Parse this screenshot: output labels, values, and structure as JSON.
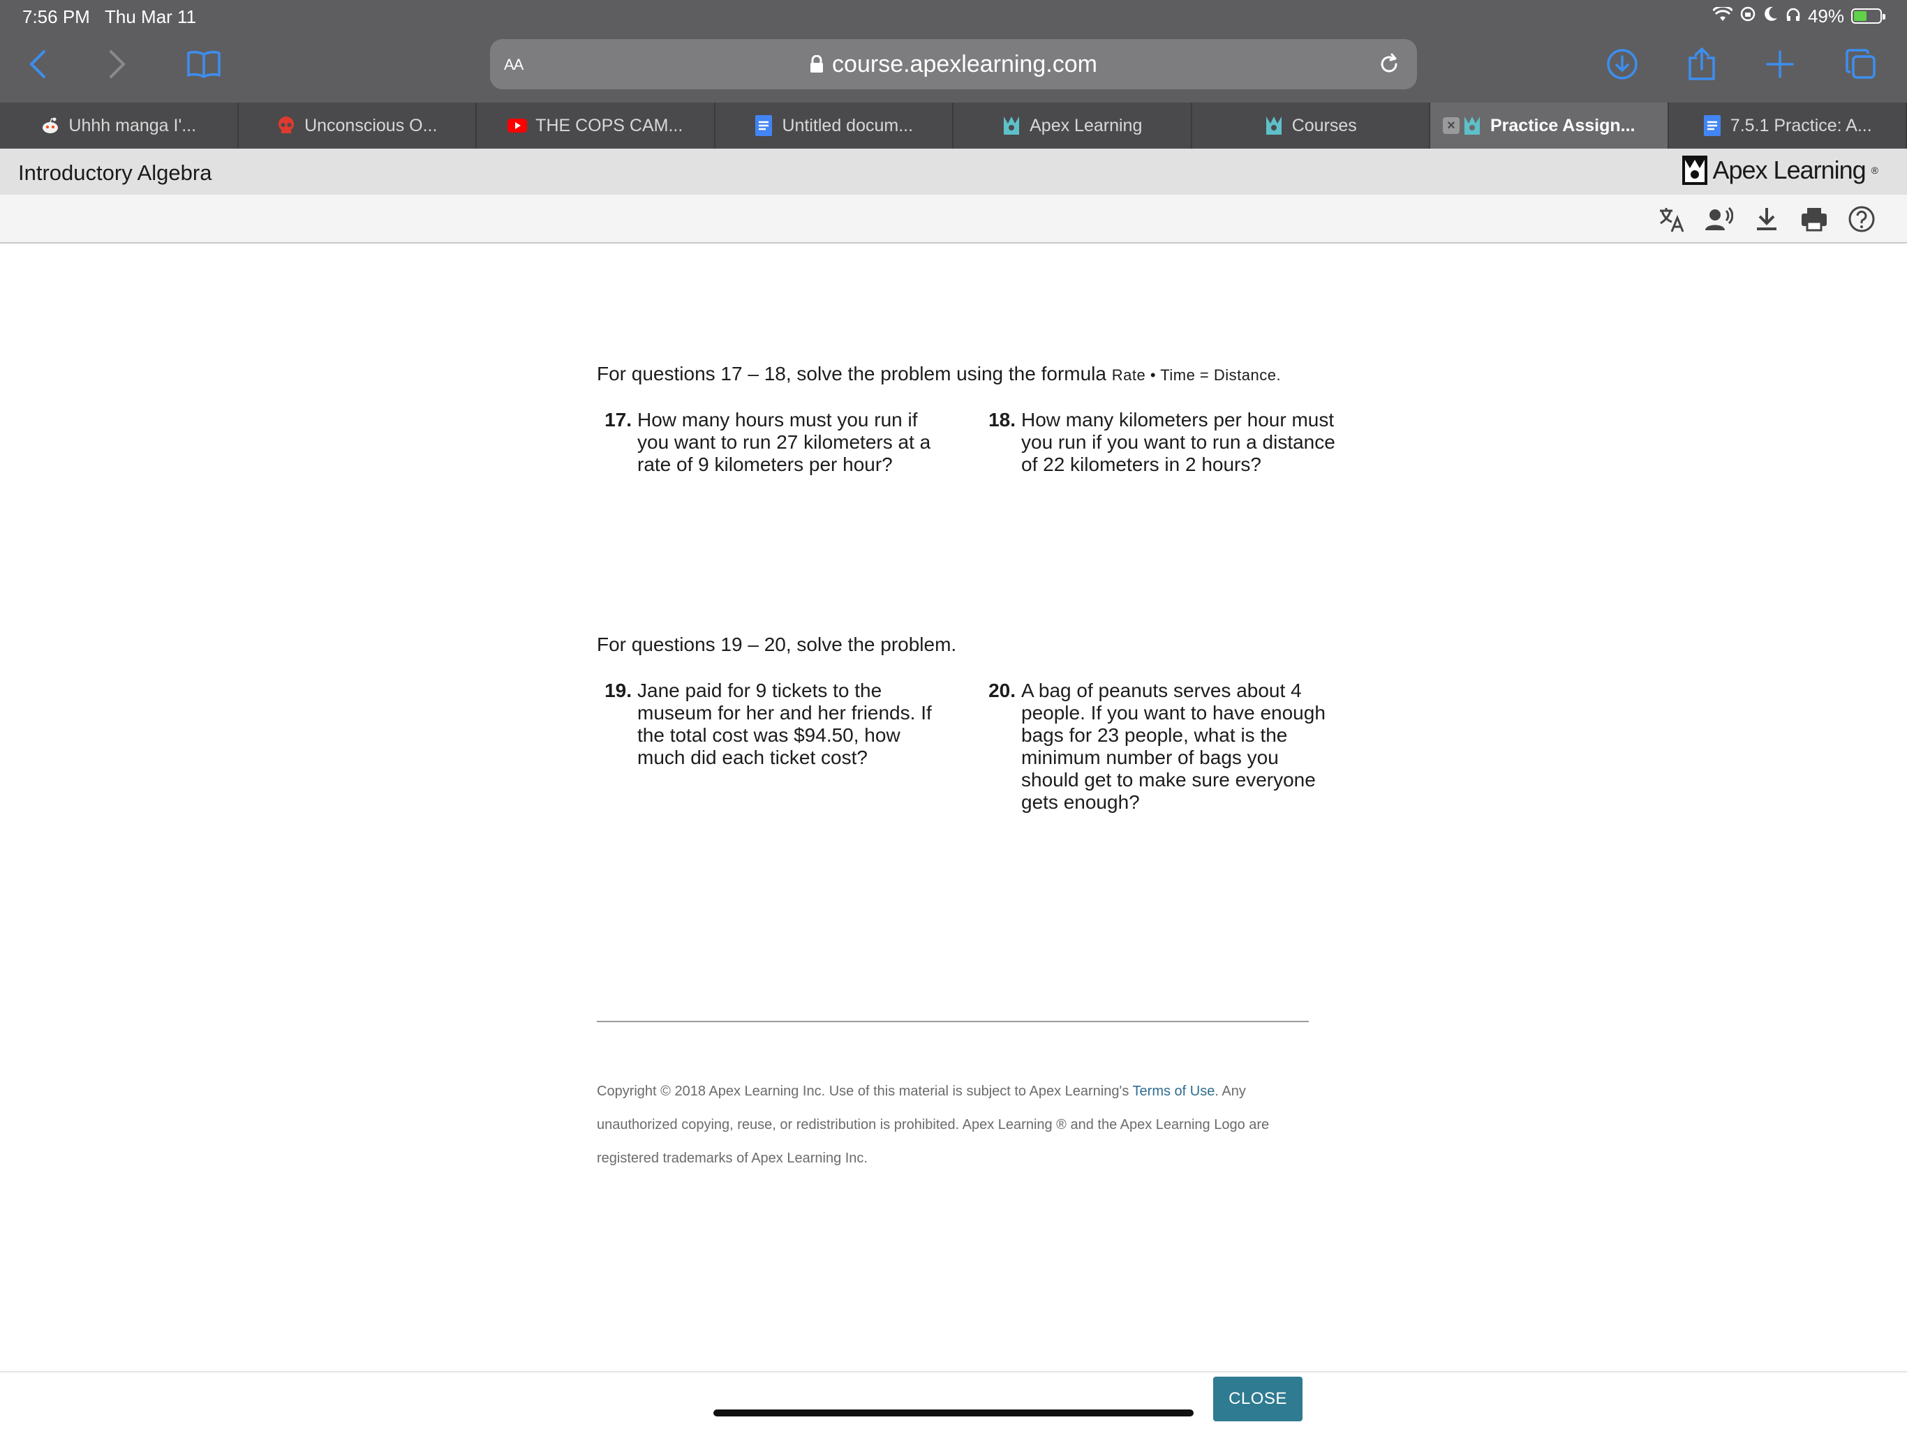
{
  "status_bar": {
    "time": "7:56 PM",
    "date": "Thu Mar 11",
    "battery": "49%",
    "battery_level": 0.49
  },
  "browser": {
    "aa_label": "AA",
    "url": "course.apexlearning.com",
    "tabs": [
      {
        "label": "Uhhh manga I'...",
        "icon": "reddit-icon"
      },
      {
        "label": "Unconscious O...",
        "icon": "skull-icon"
      },
      {
        "label": "THE COPS CAM...",
        "icon": "youtube-icon"
      },
      {
        "label": "Untitled docum...",
        "icon": "docs-icon"
      },
      {
        "label": "Apex Learning",
        "icon": "apex-icon"
      },
      {
        "label": "Courses",
        "icon": "apex-icon"
      },
      {
        "label": "Practice Assign...",
        "icon": "apex-icon",
        "active": true
      },
      {
        "label": "7.5.1 Practice: A...",
        "icon": "docs-icon"
      }
    ]
  },
  "course": {
    "title": "Introductory Algebra",
    "brand": "Apex Learning",
    "tools": [
      "translate-icon",
      "read-aloud-icon",
      "download-icon",
      "print-icon",
      "help-icon"
    ]
  },
  "content": {
    "section1_intro": "For questions 17 – 18, solve the problem using the formula",
    "formula": "Rate • Time = Distance",
    "formula_end": ".",
    "q17_num": "17.",
    "q17_text": "How many hours must you run if you want to run 27 kilometers at a rate of 9 kilometers per hour?",
    "q18_num": "18.",
    "q18_text": "How many kilometers per hour must you run if you want to run a distance of 22 kilometers in 2 hours?",
    "section2_intro": "For questions 19 – 20, solve the problem.",
    "q19_num": "19.",
    "q19_text": "Jane paid for 9 tickets to the museum for her and her friends. If the total cost was $94.50, how much did each ticket cost?",
    "q20_num": "20.",
    "q20_text": "A bag of peanuts serves about 4 people. If you want to have enough bags for 23 people, what is the minimum number of bags you should get to make sure everyone gets enough?"
  },
  "footer": {
    "copyright_pre": "Copyright © 2018 Apex Learning Inc. Use of this material is subject to Apex Learning's",
    "terms_link": "Terms of Use",
    "copyright_post": ". Any unauthorized copying, reuse, or redistribution is prohibited. Apex Learning ® and the Apex Learning Logo are registered trademarks of Apex Learning Inc.",
    "close_label": "CLOSE"
  },
  "colors": {
    "chrome": "#5e5e60",
    "accent": "#2f7b91",
    "ios_blue": "#3d8ef0",
    "link": "#2f6d8e"
  }
}
